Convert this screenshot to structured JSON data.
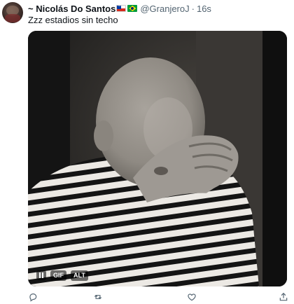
{
  "tweet": {
    "author": {
      "display_name": "~ Nicolás Do Santos",
      "flags": [
        "chile-flag",
        "brazil-flag"
      ],
      "handle": "@GranjeroJ",
      "separator": "·",
      "time": "16s"
    },
    "text": "Zzz estadios sin techo",
    "media": {
      "type": "gif",
      "description_icon": "baby-facepalm-gif",
      "controls": {
        "pause_icon": "pause-icon",
        "gif_label": "GIF",
        "alt_label": "ALT"
      }
    },
    "actions": [
      {
        "name": "reply-button",
        "icon": "reply-icon"
      },
      {
        "name": "retweet-button",
        "icon": "retweet-icon"
      },
      {
        "name": "like-button",
        "icon": "heart-icon"
      },
      {
        "name": "share-button",
        "icon": "share-icon"
      }
    ]
  },
  "colors": {
    "text_primary": "#0f1419",
    "text_secondary": "#536471",
    "icon_gray": "#536471",
    "media_bg": "#2a2826"
  }
}
